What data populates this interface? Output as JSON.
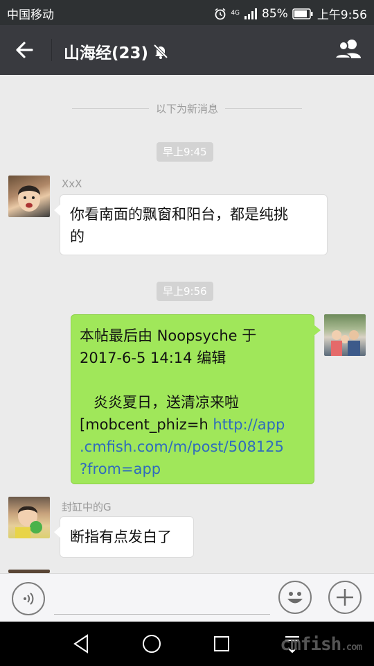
{
  "status_bar": {
    "carrier": "中国移动",
    "network": "4G",
    "battery": "85%",
    "time": "上午9:56"
  },
  "header": {
    "title": "山海经(23)",
    "back_icon": "arrow-left-icon",
    "mute_icon": "bell-muted-icon",
    "members_icon": "group-icon"
  },
  "divider": {
    "label": "以下为新消息"
  },
  "messages": [
    {
      "time": "早上9:45"
    },
    {
      "sender": "XxX",
      "text_lines": [
        "你看南面的飘窗和阳台，都是纯挑",
        "的"
      ]
    },
    {
      "time": "早上9:56"
    },
    {
      "self": true,
      "line1": " 本帖最后由 Noopsyche 于",
      "line2": "2017-6-5 14:14 编辑",
      "line3": "   炎炎夏日，送清凉来啦",
      "line4_text": "[mobcent_phiz=h ",
      "line4_link": "http://app",
      "line5_link": ".cmfish.com/m/post/508125",
      "line6_link": "?from=app"
    },
    {
      "sender": "封缸中的G",
      "text": "断指有点发白了"
    }
  ],
  "input_bar": {
    "voice_icon": "voice-icon",
    "emoji_icon": "emoji-icon",
    "plus_icon": "plus-icon"
  },
  "nav": {
    "back_icon": "triangle-back-icon",
    "home_icon": "circle-home-icon",
    "recents_icon": "square-recents-icon",
    "menu_icon": "menu-down-icon"
  },
  "watermark": {
    "text": "cmfish",
    "suffix": ".com"
  },
  "colors": {
    "self_bubble": "#a0e75a",
    "link": "#2f6bbd",
    "titlebar": "#393a3f"
  }
}
